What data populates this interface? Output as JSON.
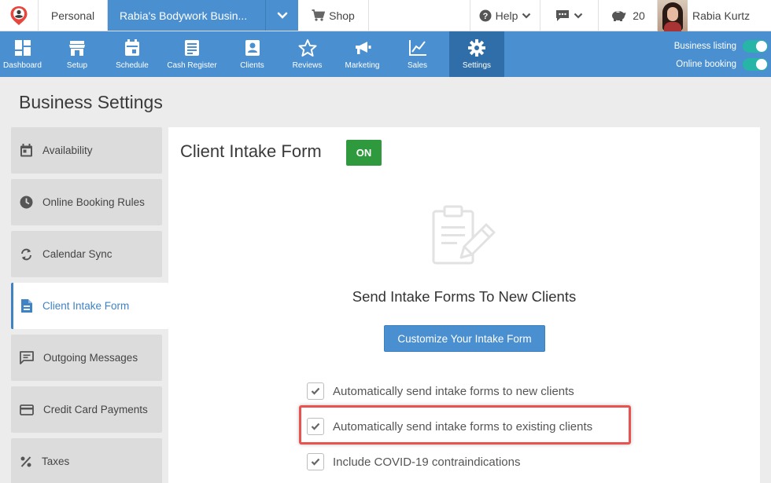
{
  "topbar": {
    "personal_label": "Personal",
    "business_label": "Rabia's Bodywork Busin...",
    "shop_label": "Shop",
    "help_label": "Help",
    "piggy_count": "20",
    "user_name": "Rabia Kurtz"
  },
  "nav": {
    "items": [
      {
        "label": "Dashboard",
        "icon": "dashboard-icon"
      },
      {
        "label": "Setup",
        "icon": "store-icon"
      },
      {
        "label": "Schedule",
        "icon": "calendar-icon"
      },
      {
        "label": "Cash Register",
        "icon": "receipt-icon"
      },
      {
        "label": "Clients",
        "icon": "contact-card-icon"
      },
      {
        "label": "Reviews",
        "icon": "star-icon"
      },
      {
        "label": "Marketing",
        "icon": "megaphone-icon"
      },
      {
        "label": "Sales",
        "icon": "line-chart-icon"
      },
      {
        "label": "Settings",
        "icon": "gear-icon"
      }
    ],
    "active": "Settings",
    "toggles": [
      {
        "label": "Business listing",
        "on": true
      },
      {
        "label": "Online booking",
        "on": true
      }
    ],
    "accent_color": "#4a8fcf",
    "toggle_color": "#26b5a6"
  },
  "page": {
    "title": "Business Settings"
  },
  "sidebar": {
    "items": [
      {
        "label": "Availability",
        "icon": "calendar-day-icon"
      },
      {
        "label": "Online Booking Rules",
        "icon": "clock-icon"
      },
      {
        "label": "Calendar Sync",
        "icon": "sync-icon"
      },
      {
        "label": "Client Intake Form",
        "icon": "document-icon"
      },
      {
        "label": "Outgoing Messages",
        "icon": "message-icon"
      },
      {
        "label": "Credit Card Payments",
        "icon": "credit-card-icon"
      },
      {
        "label": "Taxes",
        "icon": "percent-icon"
      }
    ],
    "active": "Client Intake Form"
  },
  "content": {
    "title": "Client Intake Form",
    "status_badge": "ON",
    "status_color": "#2f9a3d",
    "section_title": "Send Intake Forms To New Clients",
    "customize_button": "Customize Your Intake Form",
    "checkboxes": [
      {
        "label": "Automatically send intake forms to new clients",
        "checked": true
      },
      {
        "label": "Automatically send intake forms to existing clients",
        "checked": true,
        "highlighted": true
      },
      {
        "label": "Include COVID-19 contraindications",
        "checked": true
      }
    ],
    "highlight_color": "#e8534f"
  }
}
